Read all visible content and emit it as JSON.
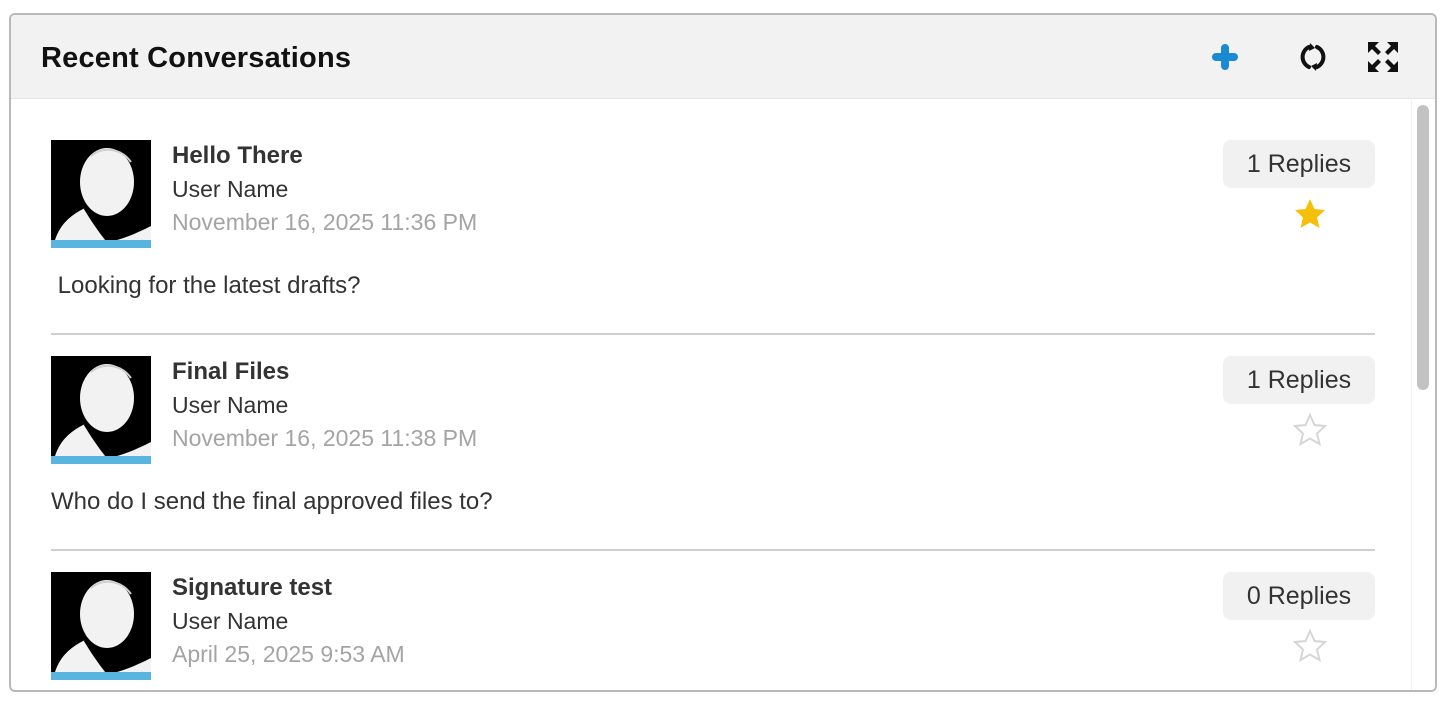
{
  "widget": {
    "title": "Recent Conversations",
    "icons": {
      "add": "plus-icon",
      "refresh": "refresh-icon",
      "expand": "expand-icon"
    },
    "colors": {
      "add_icon": "#1a8ad2",
      "avatar_bar": "#5ab4e0",
      "star_filled": "#f5bf0a",
      "star_empty": "#d6d6d6"
    }
  },
  "conversations": [
    {
      "title": "Hello There",
      "user": "User Name",
      "date": "November 16, 2025 11:36 PM",
      "replies": "1 Replies",
      "starred": true,
      "message": " Looking for the latest drafts?"
    },
    {
      "title": "Final Files",
      "user": "User Name",
      "date": "November 16, 2025 11:38 PM",
      "replies": "1 Replies",
      "starred": false,
      "message": "Who do I send the final approved files to?"
    },
    {
      "title": "Signature test",
      "user": "User Name",
      "date": "April 25, 2025 9:53 AM",
      "replies": "0 Replies",
      "starred": false,
      "message": ""
    }
  ]
}
